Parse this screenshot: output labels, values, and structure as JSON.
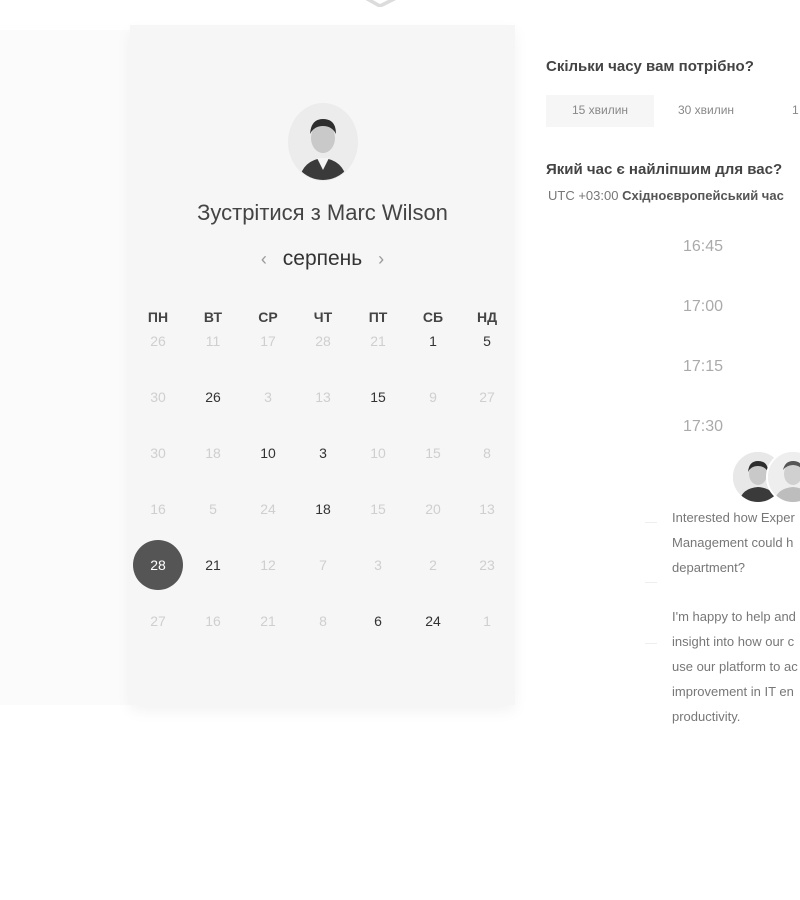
{
  "booking": {
    "title": "Зустрітися з Marc Wilson",
    "month": "серпень",
    "prev_icon": "‹",
    "next_icon": "›",
    "weekdays": [
      "ПН",
      "ВТ",
      "СР",
      "ЧТ",
      "ПТ",
      "СБ",
      "НД"
    ],
    "weeks": [
      [
        {
          "d": "26",
          "s": "muted"
        },
        {
          "d": "11",
          "s": "muted"
        },
        {
          "d": "17",
          "s": "muted"
        },
        {
          "d": "28",
          "s": "muted"
        },
        {
          "d": "21",
          "s": "muted"
        },
        {
          "d": "1",
          "s": "active"
        },
        {
          "d": "5",
          "s": "active"
        }
      ],
      [
        {
          "d": "30",
          "s": "muted"
        },
        {
          "d": "26",
          "s": "active"
        },
        {
          "d": "3",
          "s": "muted"
        },
        {
          "d": "13",
          "s": "muted"
        },
        {
          "d": "15",
          "s": "active"
        },
        {
          "d": "9",
          "s": "muted"
        },
        {
          "d": "27",
          "s": "muted"
        }
      ],
      [
        {
          "d": "30",
          "s": "muted"
        },
        {
          "d": "18",
          "s": "muted"
        },
        {
          "d": "10",
          "s": "active"
        },
        {
          "d": "3",
          "s": "active"
        },
        {
          "d": "10",
          "s": "muted"
        },
        {
          "d": "15",
          "s": "muted"
        },
        {
          "d": "8",
          "s": "muted"
        }
      ],
      [
        {
          "d": "16",
          "s": "muted"
        },
        {
          "d": "5",
          "s": "muted"
        },
        {
          "d": "24",
          "s": "muted"
        },
        {
          "d": "18",
          "s": "active"
        },
        {
          "d": "15",
          "s": "muted"
        },
        {
          "d": "20",
          "s": "muted"
        },
        {
          "d": "13",
          "s": "muted"
        }
      ],
      [
        {
          "d": "28",
          "s": "selected"
        },
        {
          "d": "21",
          "s": "active"
        },
        {
          "d": "12",
          "s": "muted"
        },
        {
          "d": "7",
          "s": "muted"
        },
        {
          "d": "3",
          "s": "muted"
        },
        {
          "d": "2",
          "s": "muted"
        },
        {
          "d": "23",
          "s": "muted"
        }
      ],
      [
        {
          "d": "27",
          "s": "muted"
        },
        {
          "d": "16",
          "s": "muted"
        },
        {
          "d": "21",
          "s": "muted"
        },
        {
          "d": "8",
          "s": "muted"
        },
        {
          "d": "6",
          "s": "active"
        },
        {
          "d": "24",
          "s": "active"
        },
        {
          "d": "1",
          "s": "muted"
        }
      ]
    ]
  },
  "duration": {
    "question": "Скільки часу вам потрібно?",
    "options": [
      "15 хвилин",
      "30 хвилин",
      "1"
    ]
  },
  "time": {
    "question": "Який час є найліпшим для вас?",
    "tz_offset": "UTC +03:00",
    "tz_name": "Східноєвропейський час",
    "slots": [
      "16:45",
      "17:00",
      "17:15",
      "17:30"
    ]
  },
  "messages": [
    "Interested how Exper\nManagement could h\ndepartment?",
    "I'm happy to help and\ninsight into how our c\nuse our platform to ac\nimprovement in IT en\nproductivity."
  ],
  "colors": {
    "selected_day": "#555555",
    "card_bg": "#f6f6f6",
    "muted_day": "#cfcfcf"
  }
}
